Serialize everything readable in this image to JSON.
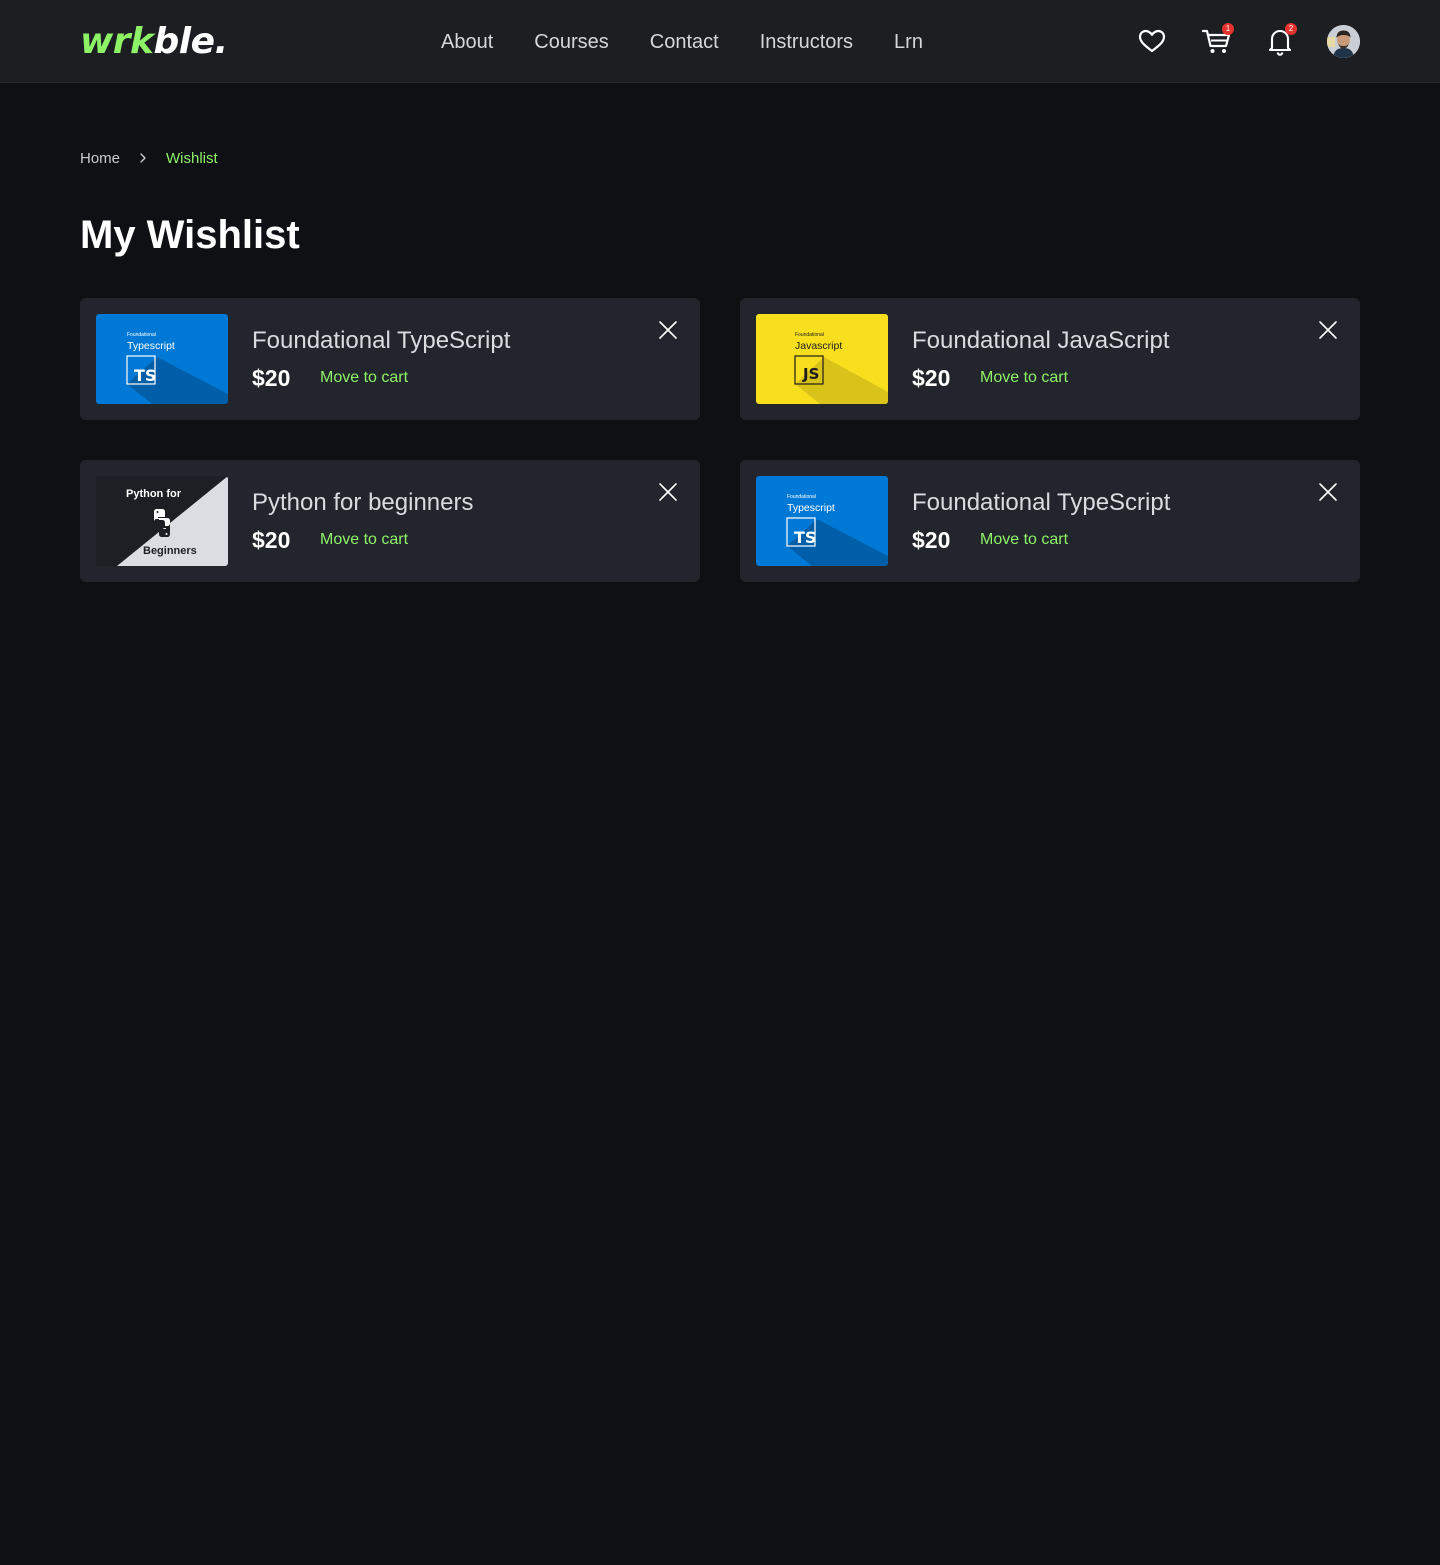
{
  "header": {
    "logo_part1": "wrk",
    "logo_part2": "ble.",
    "nav": [
      "About",
      "Courses",
      "Contact",
      "Instructors",
      "Lrn"
    ],
    "cart_badge": "1",
    "notification_badge": "2"
  },
  "breadcrumb": {
    "home": "Home",
    "current": "Wishlist"
  },
  "page": {
    "title": "My Wishlist"
  },
  "wishlist": [
    {
      "title": "Foundational TypeScript",
      "price": "$20",
      "action": "Move to cart",
      "thumb": {
        "kind": "typescript",
        "small": "Foundational",
        "label": "Typescript",
        "badge": "TS",
        "color": "#0079d6"
      }
    },
    {
      "title": "Foundational JavaScript",
      "price": "$20",
      "action": "Move to cart",
      "thumb": {
        "kind": "javascript",
        "small": "Foundational",
        "label": "Javascript",
        "badge": "JS",
        "color": "#f7df1e"
      }
    },
    {
      "title": "Python for beginners",
      "price": "$20",
      "action": "Move to cart",
      "thumb": {
        "kind": "python",
        "top": "Python for",
        "bottom": "Beginners"
      }
    },
    {
      "title": "Foundational TypeScript",
      "price": "$20",
      "action": "Move to cart",
      "thumb": {
        "kind": "typescript",
        "small": "Foundational",
        "label": "Typescript",
        "badge": "TS",
        "color": "#0079d6"
      }
    }
  ],
  "colors": {
    "accent": "#8ef267",
    "background": "#0f1013",
    "header": "#1c1e22",
    "card": "#22252b",
    "badge": "#e5322d"
  },
  "icons": [
    "heart-icon",
    "cart-icon",
    "bell-icon",
    "chevron-right-icon",
    "close-icon",
    "python-logo-icon"
  ]
}
